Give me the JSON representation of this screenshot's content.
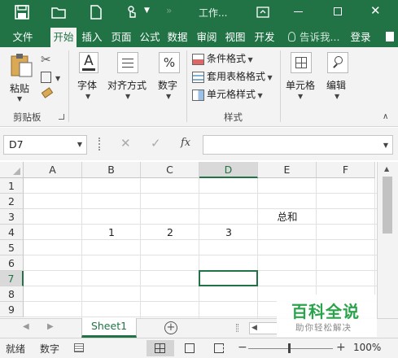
{
  "window": {
    "title": "工作..."
  },
  "tabs": [
    {
      "label": "文件"
    },
    {
      "label": "开始"
    },
    {
      "label": "插入"
    },
    {
      "label": "页面"
    },
    {
      "label": "公式"
    },
    {
      "label": "数据"
    },
    {
      "label": "审阅"
    },
    {
      "label": "视图"
    },
    {
      "label": "开发"
    }
  ],
  "tell_me": "告诉我...",
  "login": "登录",
  "ribbon": {
    "paste": "粘贴",
    "clipboard_group": "剪贴板",
    "font": "字体",
    "alignment": "对齐方式",
    "number": "数字",
    "conditional_format": "条件格式",
    "table_format": "套用表格格式",
    "cell_style": "单元格样式",
    "styles_group": "样式",
    "cells": "单元格",
    "editing": "编辑"
  },
  "formula_bar": {
    "name_box": "D7",
    "fx": "fx",
    "value": ""
  },
  "columns": [
    "A",
    "B",
    "C",
    "D",
    "E",
    "F"
  ],
  "rows": [
    "1",
    "2",
    "3",
    "4",
    "5",
    "6",
    "7",
    "8",
    "9"
  ],
  "selected_col": "D",
  "selected_row": "7",
  "cells": {
    "E3": "总和",
    "B4": "1",
    "C4": "2",
    "D4": "3"
  },
  "sheet_tab": "Sheet1",
  "status": {
    "ready": "就绪",
    "num_lock": "数字",
    "zoom": "100%"
  },
  "watermark": {
    "main": "百科全说",
    "sub": "助你轻松解决"
  },
  "colors": {
    "accent": "#217346",
    "watermark": "#2aa34a"
  }
}
